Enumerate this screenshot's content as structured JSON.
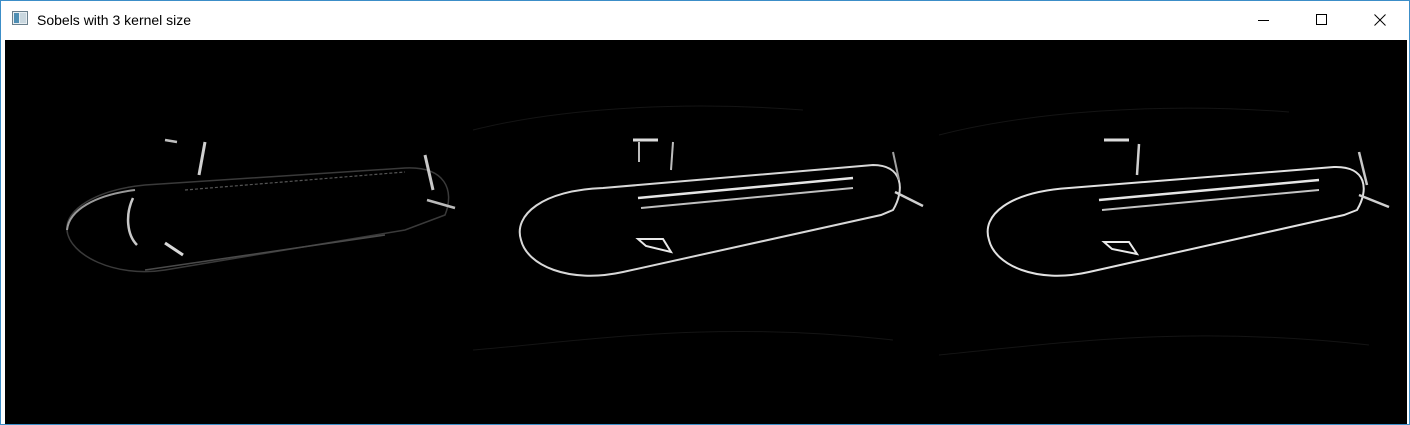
{
  "window": {
    "title": "Sobels with 3 kernel size",
    "icon": "app-window-icon",
    "controls": {
      "minimize_icon": "minimize-icon",
      "maximize_icon": "maximize-icon",
      "close_icon": "close-icon"
    },
    "border_color": "#3c8ec8"
  },
  "content": {
    "background": "#000000",
    "panels": [
      {
        "name": "sobel-x-panel",
        "edge_color": "#bbbbbb"
      },
      {
        "name": "sobel-y-panel",
        "edge_color": "#d8d8d8"
      },
      {
        "name": "sobel-combined-panel",
        "edge_color": "#e2e2e2"
      }
    ]
  }
}
